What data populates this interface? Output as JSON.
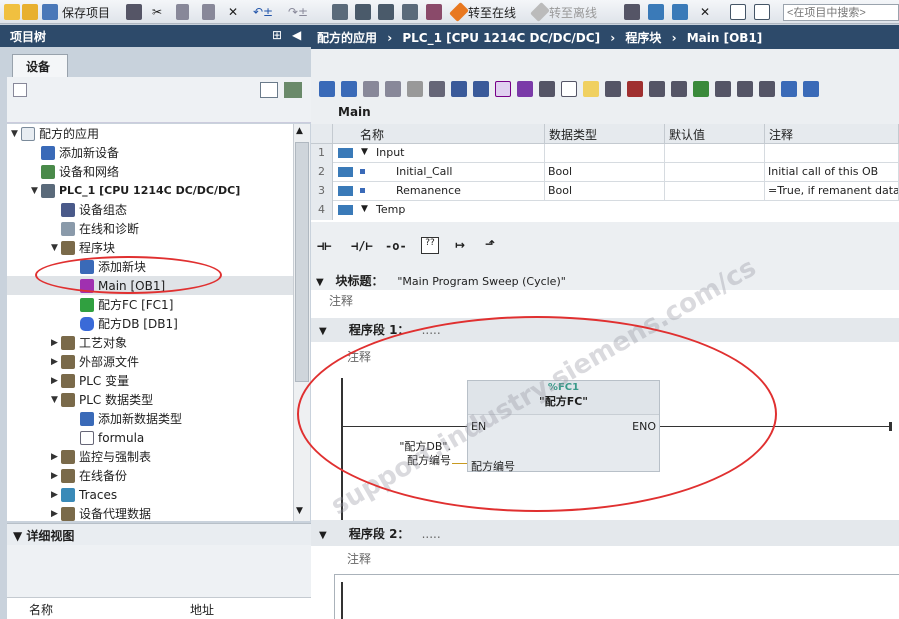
{
  "toolbar": {
    "save_project": "保存项目",
    "go_online": "转至在线",
    "go_offline": "转至离线",
    "search_placeholder": "<在项目中搜索>"
  },
  "project_tree": {
    "title": "项目树",
    "tab": "设备",
    "items": [
      {
        "label": "配方的应用",
        "icon": "project-icon"
      },
      {
        "label": "添加新设备",
        "icon": "add-device-icon"
      },
      {
        "label": "设备和网络",
        "icon": "network-icon"
      },
      {
        "label": "PLC_1 [CPU 1214C DC/DC/DC]",
        "icon": "plc-icon"
      },
      {
        "label": "设备组态",
        "icon": "device-config-icon"
      },
      {
        "label": "在线和诊断",
        "icon": "diagnostics-icon"
      },
      {
        "label": "程序块",
        "icon": "folder-icon"
      },
      {
        "label": "添加新块",
        "icon": "add-block-icon"
      },
      {
        "label": "Main [OB1]",
        "icon": "ob-icon"
      },
      {
        "label": "配方FC [FC1]",
        "icon": "fc-icon"
      },
      {
        "label": "配方DB [DB1]",
        "icon": "db-icon"
      },
      {
        "label": "工艺对象",
        "icon": "folder-icon"
      },
      {
        "label": "外部源文件",
        "icon": "folder-icon"
      },
      {
        "label": "PLC 变量",
        "icon": "folder-icon"
      },
      {
        "label": "PLC 数据类型",
        "icon": "folder-icon"
      },
      {
        "label": "添加新数据类型",
        "icon": "add-type-icon"
      },
      {
        "label": "formula",
        "icon": "type-icon"
      },
      {
        "label": "监控与强制表",
        "icon": "folder-icon"
      },
      {
        "label": "在线备份",
        "icon": "folder-icon"
      },
      {
        "label": "Traces",
        "icon": "folder-icon"
      },
      {
        "label": "设备代理数据",
        "icon": "folder-icon"
      }
    ]
  },
  "detail_view": {
    "title": "详细视图",
    "col_name": "名称",
    "col_address": "地址"
  },
  "editor": {
    "breadcrumb": [
      "配方的应用",
      "PLC_1 [CPU 1214C DC/DC/DC]",
      "程序块",
      "Main [OB1]"
    ],
    "block_name": "Main",
    "interface": {
      "headers": [
        "名称",
        "数据类型",
        "默认值",
        "注释"
      ],
      "rows": [
        {
          "num": "1",
          "name": "Input",
          "type": "",
          "default": "",
          "comment": ""
        },
        {
          "num": "2",
          "name": "Initial_Call",
          "type": "Bool",
          "default": "",
          "comment": "Initial call of this OB"
        },
        {
          "num": "3",
          "name": "Remanence",
          "type": "Bool",
          "default": "",
          "comment": "=True, if remanent data"
        },
        {
          "num": "4",
          "name": "Temp",
          "type": "",
          "default": "",
          "comment": ""
        }
      ]
    },
    "block_title_label": "块标题：",
    "block_title_value": "\"Main Program Sweep (Cycle)\"",
    "comment_label": "注释",
    "network1": {
      "label": "程序段 1：",
      "dots": ".....",
      "comment": "注释",
      "fc_address": "%FC1",
      "fc_name": "\"配方FC\"",
      "en": "EN",
      "eno": "ENO",
      "param_operand_line1": "\"配方DB\".",
      "param_operand_line2": "配方编号",
      "param_name": "配方编号"
    },
    "network2": {
      "label": "程序段 2：",
      "dots": ".....",
      "comment": "注释"
    }
  },
  "colors": {
    "title_bar": "#2d4a6a",
    "annotation": "#e03030",
    "fc_header": "#3a9a8a"
  }
}
